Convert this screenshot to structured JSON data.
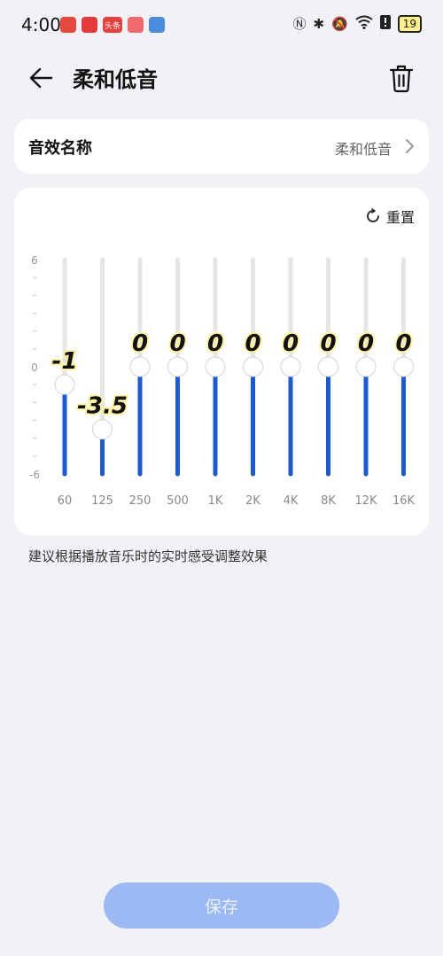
{
  "status": {
    "time": "4:00",
    "apps": [
      {
        "name": "app-icon-red",
        "color": "#e5483c",
        "text": ""
      },
      {
        "name": "app-icon-store",
        "color": "#e63a3a",
        "text": ""
      },
      {
        "name": "app-icon-toutiao",
        "color": "#e8403a",
        "text": "头条"
      },
      {
        "name": "app-icon-pink",
        "color": "#f26a6a",
        "text": ""
      },
      {
        "name": "app-icon-blue",
        "color": "#4a8de0",
        "text": ""
      }
    ],
    "battery": "19"
  },
  "header": {
    "title": "柔和低音"
  },
  "name_row": {
    "label": "音效名称",
    "value": "柔和低音"
  },
  "eq": {
    "reset_label": "重置",
    "y_max_label": "6",
    "y_zero_label": "0",
    "y_min_label": "-6",
    "accent_color": "#1a5ad8",
    "track_color": "#e5e5e5"
  },
  "chart_data": {
    "type": "equalizer",
    "categories": [
      "60",
      "125",
      "250",
      "500",
      "1K",
      "2K",
      "4K",
      "8K",
      "12K",
      "16K"
    ],
    "values": [
      -1,
      -3.5,
      0,
      0,
      0,
      0,
      0,
      0,
      0,
      0
    ],
    "value_labels": [
      "-1",
      "-3.5",
      "0",
      "0",
      "0",
      "0",
      "0",
      "0",
      "0",
      "0"
    ],
    "ylim": [
      -6,
      6
    ]
  },
  "hint": "建议根据播放音乐时的实时感受调整效果",
  "save_label": "保存"
}
